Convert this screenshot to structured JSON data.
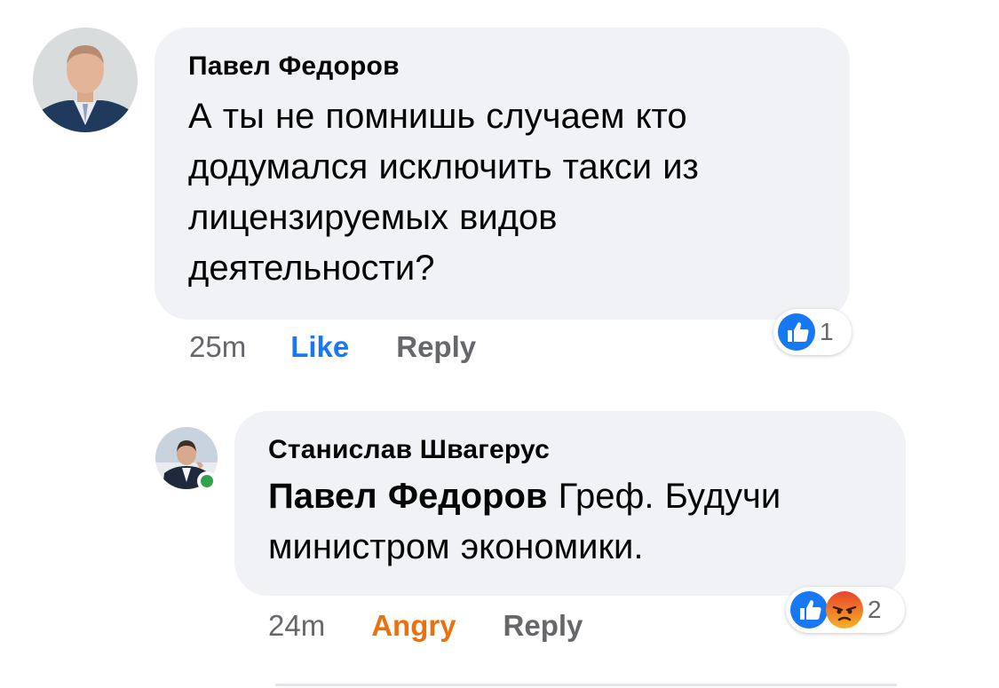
{
  "comments": [
    {
      "author": "Павел Федоров",
      "text_lines": [
        "А ты не помнишь случаем кто",
        "додумался исключить такси из",
        "лицензируемых видов",
        "деятельности?"
      ],
      "time": "25m",
      "reaction_label": "Like",
      "reply_label": "Reply",
      "reaction_count": "1",
      "reaction_icons": [
        "like-icon"
      ]
    },
    {
      "author": "Станислав Швагерус",
      "mention": "Павел Федоров",
      "text_line1_rest": " Греф. Будучи",
      "text_line2": "министром экономики.",
      "time": "24m",
      "reaction_label": "Angry",
      "reply_label": "Reply",
      "reaction_count": "2",
      "reaction_icons": [
        "like-icon",
        "angry-icon"
      ],
      "online": true
    }
  ],
  "colors": {
    "bubble": "#f0f2f5",
    "like_blue": "#1877f2",
    "angry_orange": "#e9710f",
    "meta_gray": "#65676b",
    "online_green": "#31a24c",
    "highlight": "#fbf1a9"
  }
}
